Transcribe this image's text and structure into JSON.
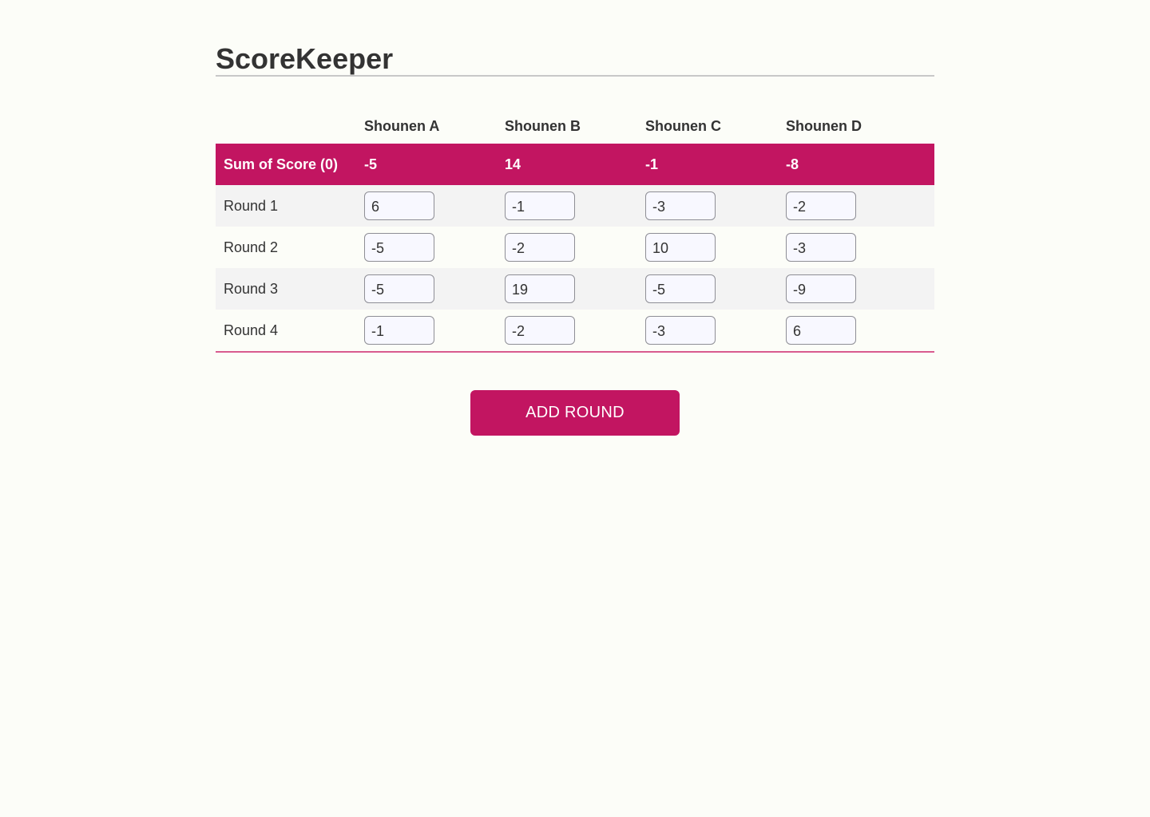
{
  "app": {
    "title": "ScoreKeeper"
  },
  "table": {
    "players": [
      "Shounen A",
      "Shounen B",
      "Shounen C",
      "Shounen D"
    ],
    "sum_row": {
      "label": "Sum of Score (0)",
      "values": [
        "-5",
        "14",
        "-1",
        "-8"
      ]
    },
    "rounds": [
      {
        "label": "Round 1",
        "scores": [
          "6",
          "-1",
          "-3",
          "-2"
        ]
      },
      {
        "label": "Round 2",
        "scores": [
          "-5",
          "-2",
          "10",
          "-3"
        ]
      },
      {
        "label": "Round 3",
        "scores": [
          "-5",
          "19",
          "-5",
          "-9"
        ]
      },
      {
        "label": "Round 4",
        "scores": [
          "-1",
          "-2",
          "-3",
          "6"
        ]
      }
    ]
  },
  "actions": {
    "add_round_label": "ADD ROUND"
  },
  "colors": {
    "accent": "#c21561",
    "background": "#fcfdf8",
    "stripe": "#f3f3f3"
  }
}
